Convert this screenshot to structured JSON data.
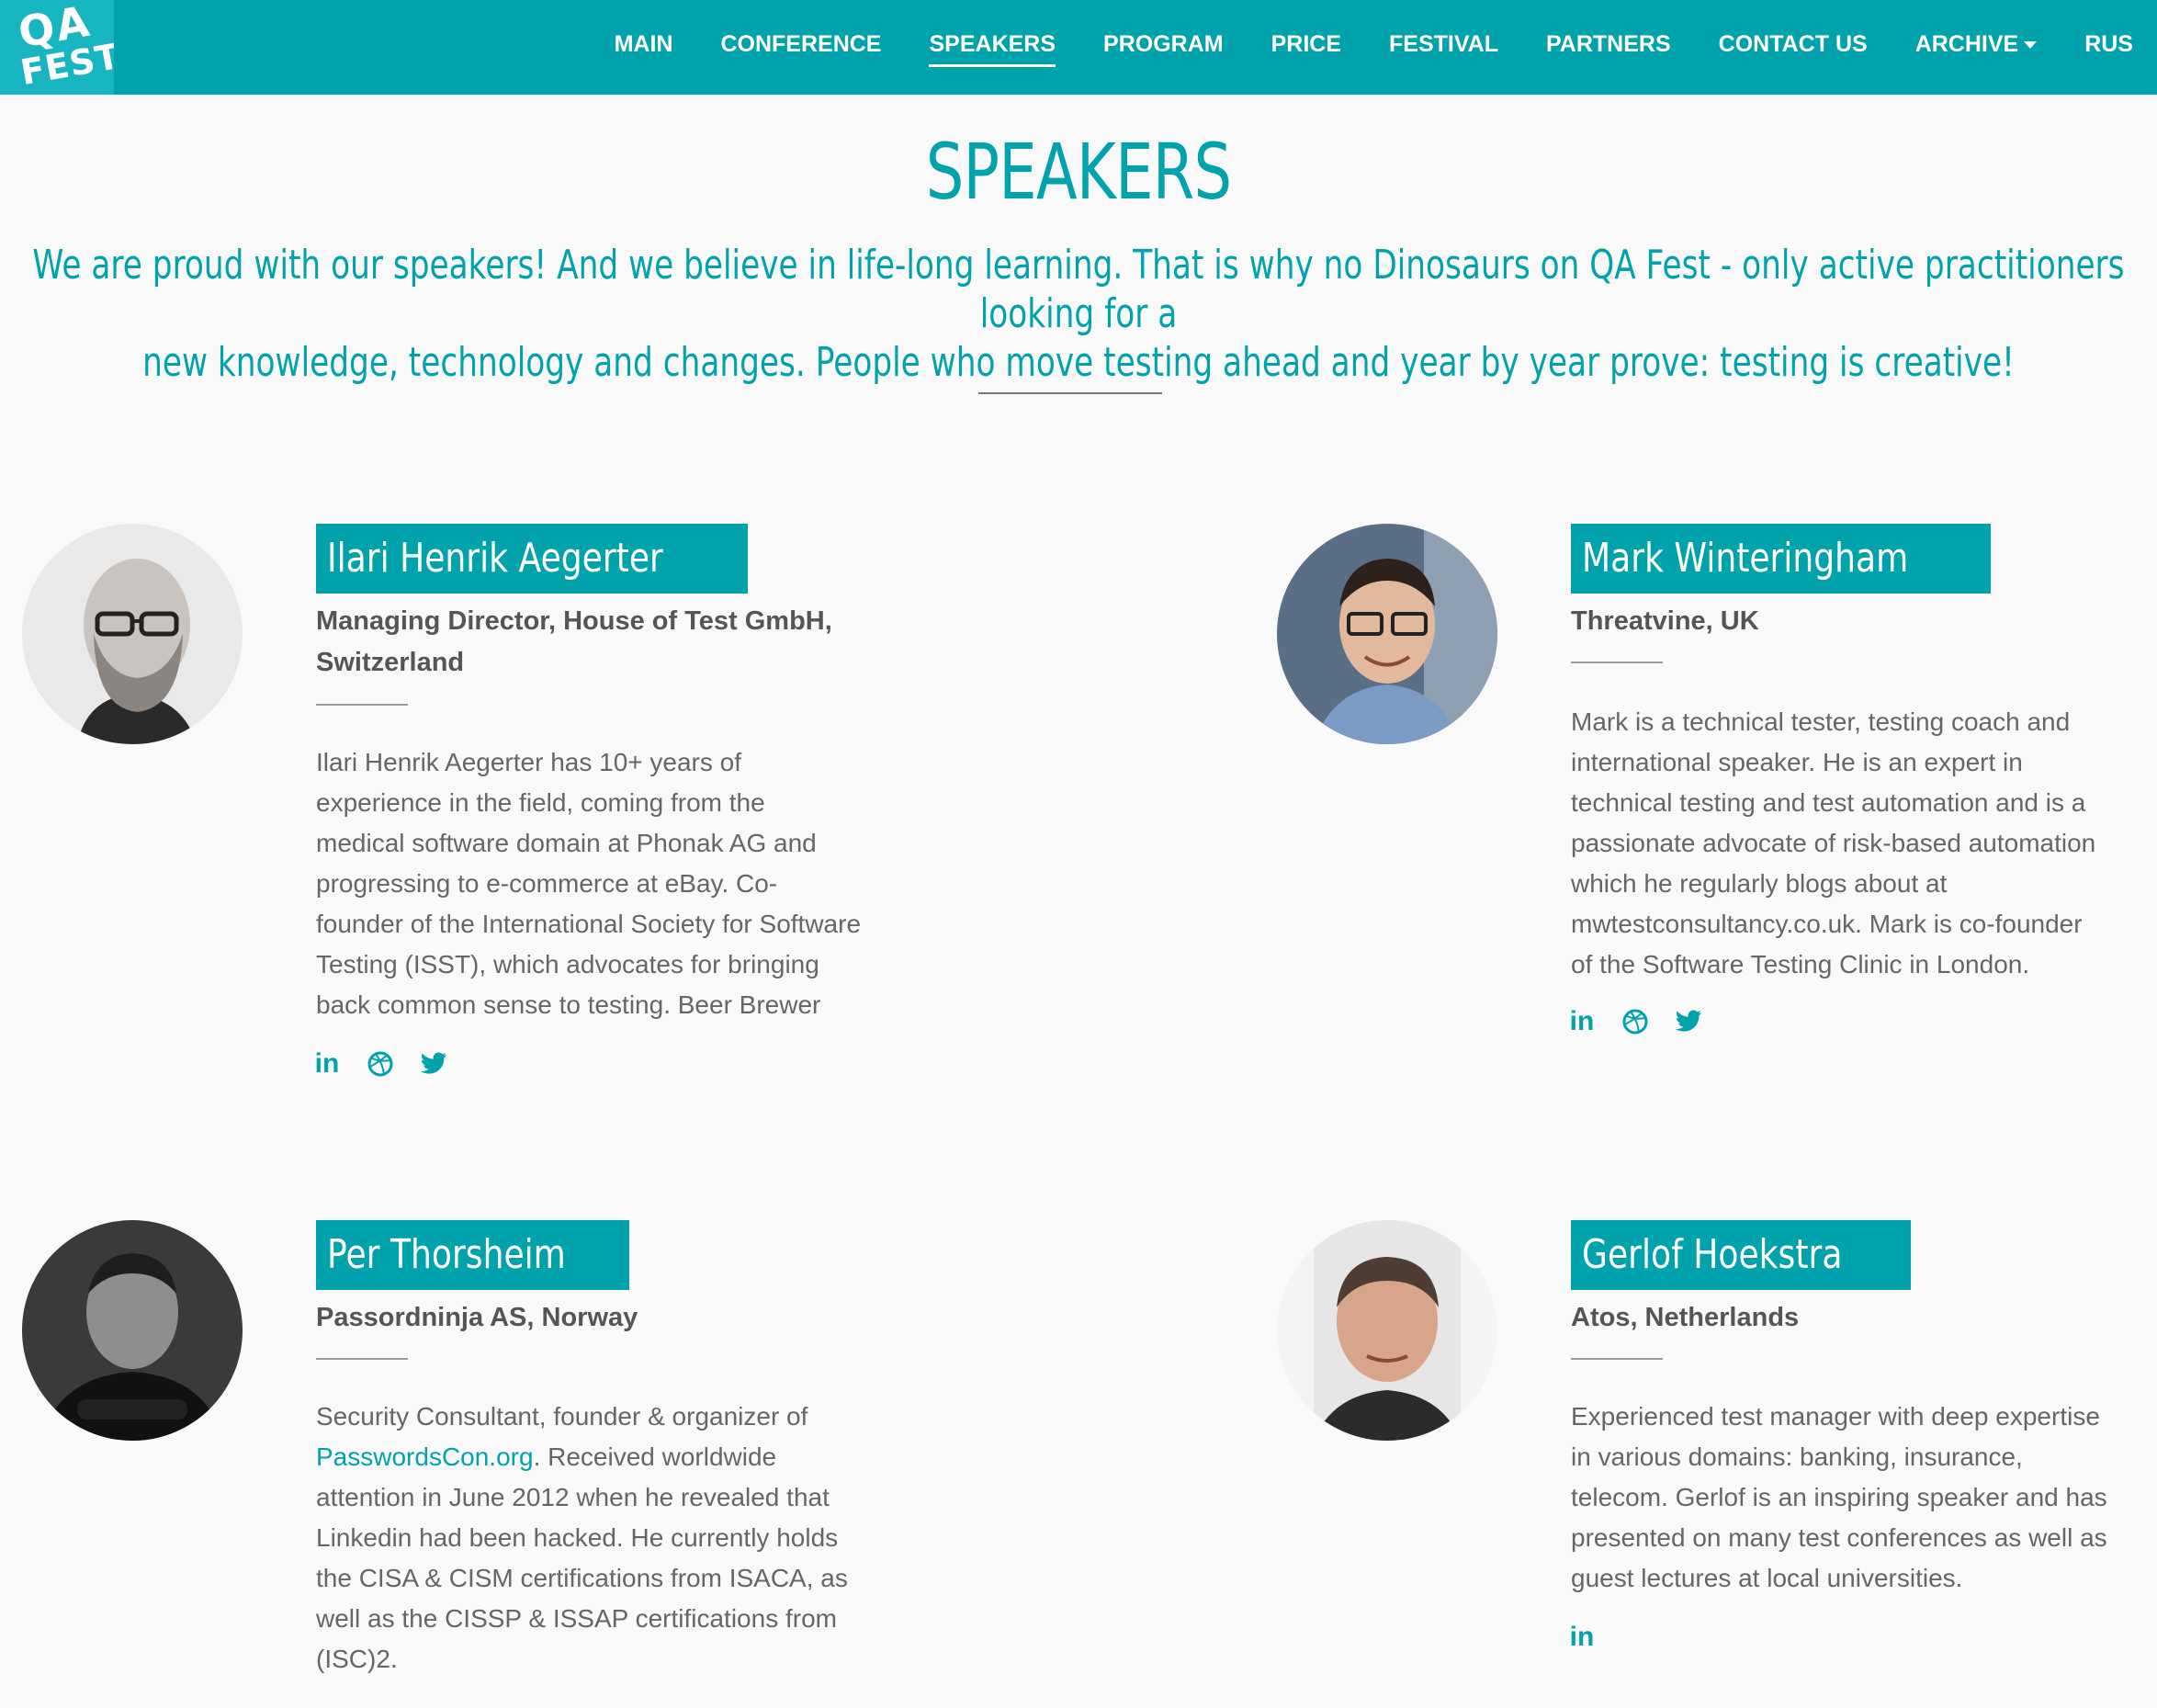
{
  "header": {
    "logo": [
      "QA",
      "FEST"
    ],
    "nav": [
      {
        "label": "MAIN"
      },
      {
        "label": "CONFERENCE"
      },
      {
        "label": "SPEAKERS",
        "active": true
      },
      {
        "label": "PROGRAM"
      },
      {
        "label": "PRICE"
      },
      {
        "label": "FESTIVAL"
      },
      {
        "label": "PARTNERS"
      },
      {
        "label": "CONTACT US"
      },
      {
        "label": "ARCHIVE"
      },
      {
        "label": "RUS"
      }
    ]
  },
  "page": {
    "title": "SPEAKERS",
    "intro_line1": "We are proud with our speakers! And we believe in life-long learning. That is why no Dinosaurs on QA Fest - only active practitioners looking for a",
    "intro_line2": "new knowledge, technology and changes. People who move testing ahead and year by year prove: testing is creative!"
  },
  "speakers": [
    {
      "name": "Ilari Henrik Aegerter",
      "company_line1": "Managing Director, House of Test GmbH,",
      "company_line2": "Switzerland",
      "bio": [
        "Ilari Henrik Aegerter has 10+ years of",
        "experience in the field, coming from the",
        "medical software domain at Phonak AG and",
        "progressing to e-commerce at eBay. Co-",
        "founder of the International Society for Software",
        "Testing (ISST), which advocates for bringing",
        "back common sense to testing. Beer Brewer"
      ],
      "socials": [
        "linkedin-icon",
        "dribbble-icon",
        "twitter-icon"
      ]
    },
    {
      "name": "Mark Winteringham",
      "company_line1": "Threatvine, UK",
      "bio": [
        "Mark is a technical tester, testing coach and",
        "international speaker. He is an expert in",
        "technical testing and test automation and is a",
        "passionate advocate of risk-based automation",
        "which he regularly blogs about at",
        "mwtestconsultancy.co.uk. Mark is co-founder",
        "of the Software Testing Clinic in London."
      ],
      "socials": [
        "linkedin-icon",
        "dribbble-icon",
        "twitter-icon"
      ]
    },
    {
      "name": "Per Thorsheim",
      "company_line1": "Passordninja AS, Norway",
      "bio_link": "PasswordsCon.org",
      "bio": [
        "Security Consultant, founder & organizer of",
        ". Received worldwide",
        "attention in June 2012 when he revealed that",
        "Linkedin had been hacked. He currently holds",
        "the CISA & CISM certifications from ISACA, as",
        "well as the CISSP & ISSAP certifications from",
        "(ISC)2."
      ]
    },
    {
      "name": "Gerlof Hoekstra",
      "company_line1": "Atos, Netherlands",
      "bio": [
        "Experienced test manager with deep expertise",
        "in various domains: banking, insurance,",
        "telecom. Gerlof is an inspiring speaker and has",
        "presented on many test conferences as well as",
        "guest lectures at local universities."
      ],
      "socials": [
        "linkedin-icon"
      ]
    }
  ],
  "colors": {
    "accent": "#00a2ac",
    "background": "#f9f9f9",
    "text": "#555555"
  }
}
